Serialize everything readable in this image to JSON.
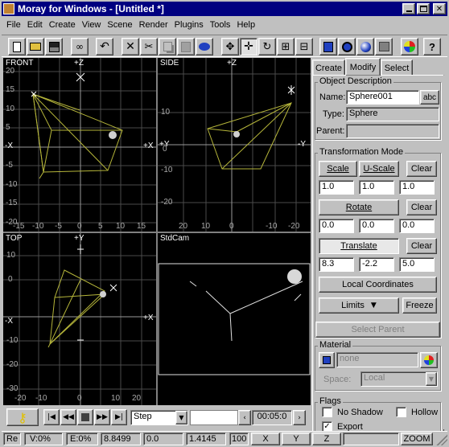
{
  "window": {
    "title": "Moray for Windows - [Untitled *]"
  },
  "menu": [
    "File",
    "Edit",
    "Create",
    "View",
    "Scene",
    "Render",
    "Plugins",
    "Tools",
    "Help"
  ],
  "viewports": {
    "front": {
      "name": "FRONT",
      "axis_top": "+Z",
      "axis_left": "-X",
      "axis_right": "+X",
      "y_labels": [
        "20",
        "15",
        "10",
        "5",
        "0",
        "-5",
        "-10",
        "-15",
        "-20"
      ],
      "x_labels": [
        "-15",
        "-10",
        "-5",
        "0",
        "5",
        "10",
        "15"
      ]
    },
    "side": {
      "name": "SIDE",
      "axis_top": "+Z",
      "axis_left": "+Y",
      "axis_right": "-Y",
      "y_labels": [
        "10",
        "0",
        "-10",
        "-20"
      ],
      "x_labels": [
        "20",
        "10",
        "0",
        "-10",
        "-20"
      ]
    },
    "top": {
      "name": "TOP",
      "axis_top": "+Y",
      "axis_left": "-X",
      "axis_right": "+X",
      "y_labels": [
        "10",
        "0",
        "-10",
        "-20",
        "-30"
      ],
      "x_labels": [
        "-20",
        "-10",
        "0",
        "10",
        "20"
      ]
    },
    "camera": {
      "name": "StdCam"
    }
  },
  "tabs": [
    "Create",
    "Modify",
    "Select"
  ],
  "panel": {
    "object_description": "Object Description",
    "name_label": "Name:",
    "name_value": "Sphere001",
    "abc_label": "abc",
    "type_label": "Type:",
    "type_value": "Sphere",
    "parent_label": "Parent:",
    "parent_value": "",
    "transformation_mode": "Transformation Mode",
    "scale": "Scale",
    "u_scale": "U-Scale",
    "clear": "Clear",
    "scale_values": [
      "1.0",
      "1.0",
      "1.0"
    ],
    "rotate": "Rotate",
    "rotate_values": [
      "0.0",
      "0.0",
      "0.0"
    ],
    "translate": "Translate",
    "translate_values": [
      "8.3",
      "-2.2",
      "5.0"
    ],
    "local_coordinates": "Local Coordinates",
    "limits": "Limits",
    "freeze": "Freeze",
    "select_parent": "Select Parent",
    "material": "Material",
    "material_value": "none",
    "space_label": "Space:",
    "space_value": "Local",
    "flags": "Flags",
    "no_shadow": "No Shadow",
    "hollow": "Hollow",
    "export": "Export",
    "no_shadow_checked": false,
    "hollow_checked": false,
    "export_checked": true
  },
  "anim": {
    "mode": "Step",
    "time": "00:05:0"
  },
  "status": {
    "re": "Re",
    "v": "V:0%",
    "e": "E:0%",
    "val1": "8.8499",
    "val2": "0.0",
    "val3": "1.4145",
    "grid": "100",
    "x": "X",
    "y": "Y",
    "z": "Z",
    "zoom": "ZOOM"
  },
  "colors": {
    "titlebar": "#000080",
    "viewport_bg": "#000000",
    "wire": "#b5b53a",
    "grid": "#4a4a4a",
    "axis": "#9a9a9a"
  }
}
